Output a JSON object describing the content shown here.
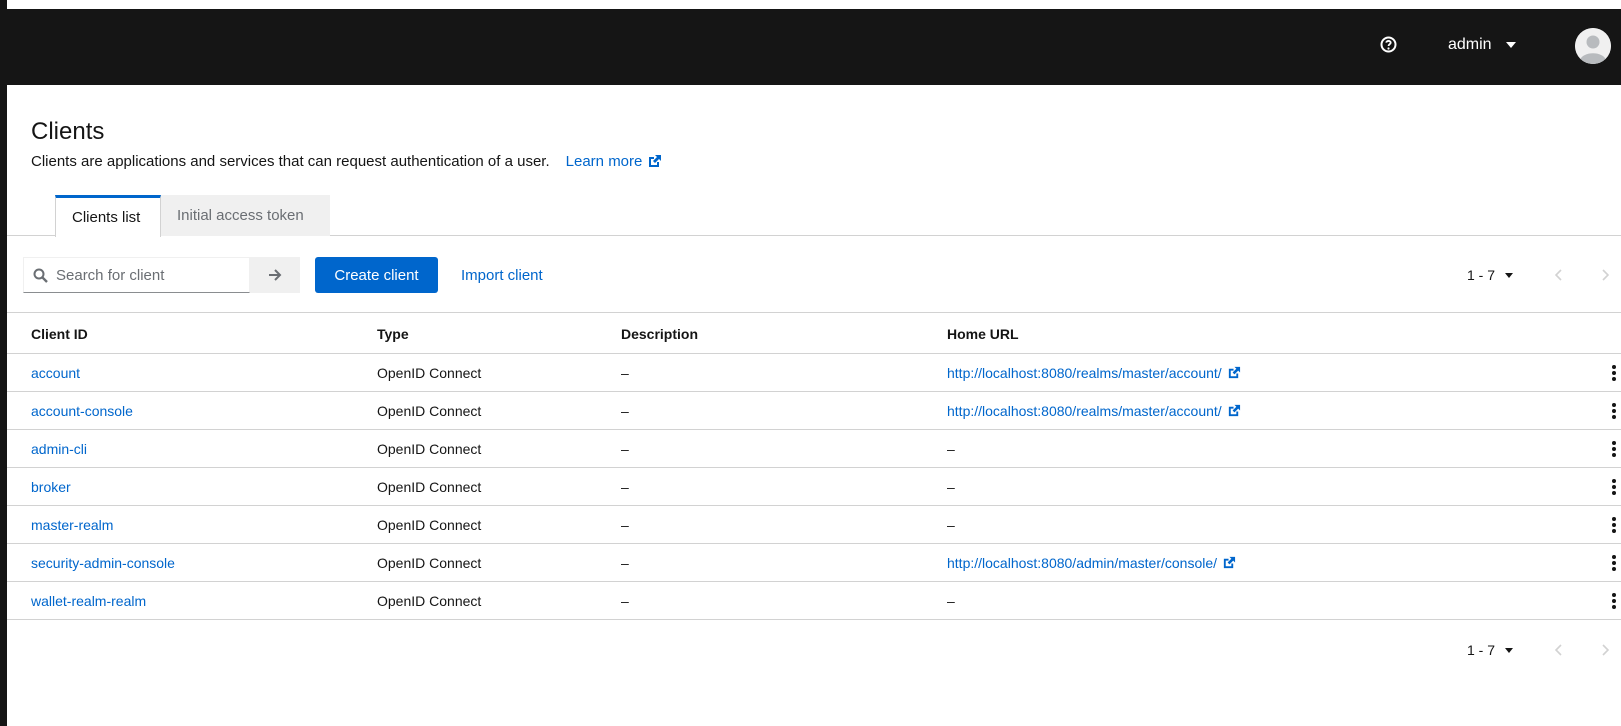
{
  "masthead": {
    "help_icon": "question-circle-icon",
    "username": "admin",
    "avatar_icon": "user-avatar-icon"
  },
  "page": {
    "title": "Clients",
    "description": "Clients are applications and services that can request authentication of a user.",
    "learn_more": "Learn more"
  },
  "tabs": [
    {
      "label": "Clients list",
      "active": true
    },
    {
      "label": "Initial access token",
      "active": false
    }
  ],
  "toolbar": {
    "search_placeholder": "Search for client",
    "create_label": "Create client",
    "import_label": "Import client"
  },
  "pagination": {
    "range": "1 - 7"
  },
  "table": {
    "headers": [
      "Client ID",
      "Type",
      "Description",
      "Home URL"
    ],
    "rows": [
      {
        "client_id": "account",
        "type": "OpenID Connect",
        "description": "–",
        "home_url": "http://localhost:8080/realms/master/account/"
      },
      {
        "client_id": "account-console",
        "type": "OpenID Connect",
        "description": "–",
        "home_url": "http://localhost:8080/realms/master/account/"
      },
      {
        "client_id": "admin-cli",
        "type": "OpenID Connect",
        "description": "–",
        "home_url": "–"
      },
      {
        "client_id": "broker",
        "type": "OpenID Connect",
        "description": "–",
        "home_url": "–"
      },
      {
        "client_id": "master-realm",
        "type": "OpenID Connect",
        "description": "–",
        "home_url": "–"
      },
      {
        "client_id": "security-admin-console",
        "type": "OpenID Connect",
        "description": "–",
        "home_url": "http://localhost:8080/admin/master/console/"
      },
      {
        "client_id": "wallet-realm-realm",
        "type": "OpenID Connect",
        "description": "–",
        "home_url": "–"
      }
    ]
  },
  "colors": {
    "masthead": "#151515",
    "link": "#0066cc",
    "primary": "#0066cc",
    "border": "#d2d2d2"
  }
}
